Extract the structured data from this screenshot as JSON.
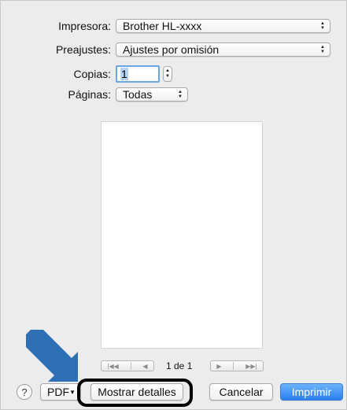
{
  "printer": {
    "label": "Impresora:",
    "value": "Brother HL-xxxx"
  },
  "presets": {
    "label": "Preajustes:",
    "value": "Ajustes por omisión"
  },
  "copies": {
    "label": "Copias:",
    "value": "1"
  },
  "pages": {
    "label": "Páginas:",
    "value": "Todas"
  },
  "preview": {
    "page_indicator": "1 de 1"
  },
  "footer": {
    "help_glyph": "?",
    "pdf_label": "PDF",
    "details_label": "Mostrar detalles",
    "cancel_label": "Cancelar",
    "print_label": "Imprimir"
  },
  "annotation": {
    "arrow_color": "#2f6fb6",
    "ring_color": "#000000"
  },
  "colors": {
    "accent": "#2a7ff0",
    "dialog_bg": "#ececec"
  }
}
